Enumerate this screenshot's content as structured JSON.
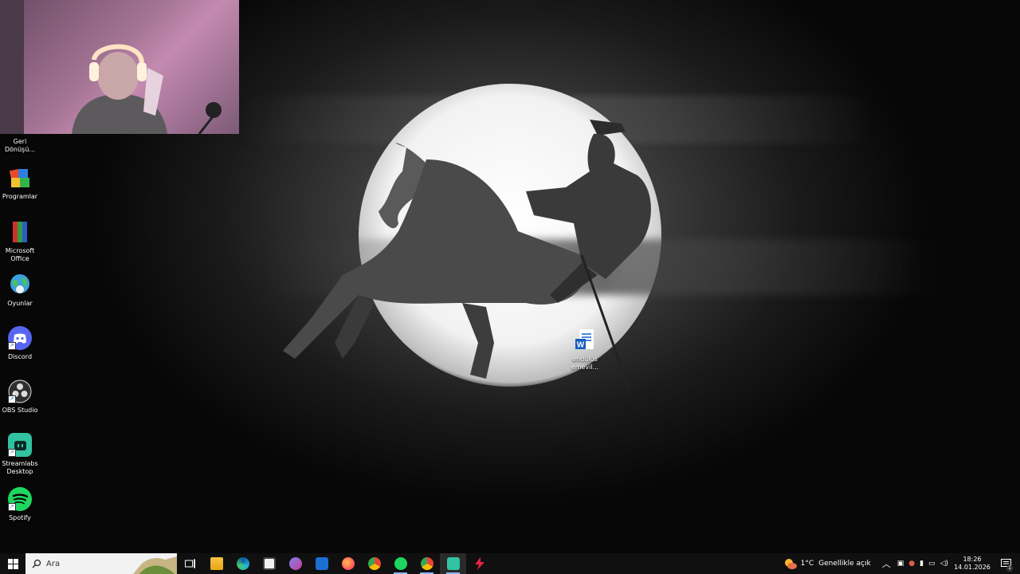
{
  "desktop": {
    "icons": [
      {
        "label": "Geri Dönüşü...",
        "icon": "recycle-bin-icon"
      },
      {
        "label": "Programlar",
        "icon": "programs-folder-icon"
      },
      {
        "label": "Microsoft Office",
        "icon": "office-folder-icon"
      },
      {
        "label": "Oyunlar",
        "icon": "games-globe-icon"
      },
      {
        "label": "Discord",
        "icon": "discord-icon"
      },
      {
        "label": "OBS Studio",
        "icon": "obs-icon"
      },
      {
        "label": "Streamlabs Desktop",
        "icon": "streamlabs-icon"
      },
      {
        "label": "Spotify",
        "icon": "spotify-icon"
      }
    ],
    "file": {
      "label": "endülüs emevil...",
      "icon": "word-doc-icon"
    }
  },
  "taskbar": {
    "search_placeholder": "Ara",
    "apps": [
      "task-view-icon",
      "file-explorer-icon",
      "edge-icon",
      "store-icon",
      "teams-icon",
      "mail-icon",
      "firefox-icon",
      "chrome-icon",
      "spotify-icon",
      "chrome-profile-icon",
      "streamlabs-icon",
      "app-red-icon"
    ],
    "weather": {
      "temp": "1°C",
      "condition": "Genellikle açık"
    },
    "clock": {
      "time": "18:26",
      "date": "14.01.2026"
    },
    "notification_count": "1"
  },
  "colors": {
    "taskbar_bg": "#101010",
    "accent": "#8ab4f8"
  }
}
